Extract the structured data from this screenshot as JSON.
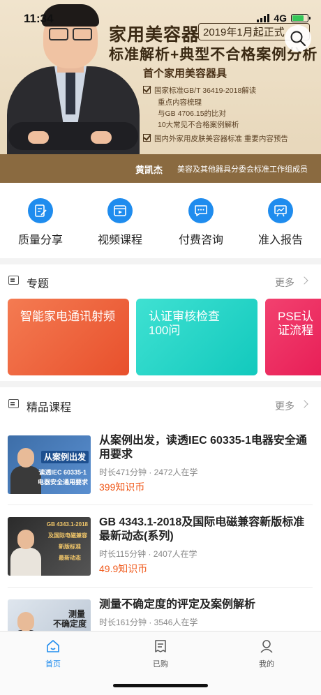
{
  "status_bar": {
    "time": "11:34",
    "network": "4G"
  },
  "banner": {
    "title": "家用美容器",
    "date_badge": "2019年1月起正式",
    "subtitle": "标准解析+典型不合格案例分析",
    "section": "首个家用美容器具",
    "check1": "国家标准GB/T 36419-2018解读",
    "line1": "重点内容梳理",
    "line2": "与GB 4706.15的比对",
    "line3": "10大常见不合格案例解析",
    "check2": "国内外家用皮肤美容器标准 重要内容预告",
    "speaker": "黄凯杰",
    "speaker_org": "美容及其他器具分委会标准工作组成员"
  },
  "quick_entries": [
    {
      "label": "质量分享",
      "icon": "edit-doc-icon"
    },
    {
      "label": "视频课程",
      "icon": "video-icon"
    },
    {
      "label": "付费咨询",
      "icon": "chat-icon"
    },
    {
      "label": "准入报告",
      "icon": "report-icon"
    }
  ],
  "topics_section": {
    "title": "专题",
    "more": "更多"
  },
  "topics": [
    {
      "title": "智能家电通讯射频",
      "color_from": "#f47b52",
      "color_to": "#e8502c"
    },
    {
      "title": "认证审核检查100问",
      "color_from": "#3fe1d2",
      "color_to": "#12c9bd"
    },
    {
      "title": "PSE认证流程",
      "color_from": "#f2416f",
      "color_to": "#e81f57"
    }
  ],
  "courses_section": {
    "title": "精品课程",
    "more": "更多"
  },
  "courses": [
    {
      "title": "从案例出发，读透IEC 60335-1电器安全通用要求",
      "meta": "时长471分钟 · 2472人在学",
      "price": "399知识币",
      "thumb_line1": "从案例出发",
      "thumb_line2": "读透IEC 60335-1",
      "thumb_line3": "电器安全通用要求"
    },
    {
      "title": "GB 4343.1-2018及国际电磁兼容新版标准最新动态(系列)",
      "meta": "时长115分钟 · 2407人在学",
      "price": "49.9知识币",
      "thumb_line1": "GB 4343.1-2018",
      "thumb_line2": "及国际电磁兼容",
      "thumb_line3": "新版标准",
      "thumb_line4": "最新动态"
    },
    {
      "title": "测量不确定度的评定及案例解析",
      "meta": "时长161分钟 · 3546人在学",
      "price": "",
      "thumb_line1": "测量",
      "thumb_line2": "不确定度"
    }
  ],
  "tabbar": [
    {
      "label": "首页",
      "icon": "home-icon",
      "active": true
    },
    {
      "label": "已购",
      "icon": "purchased-icon",
      "active": false
    },
    {
      "label": "我的",
      "icon": "profile-icon",
      "active": false
    }
  ],
  "colors": {
    "accent": "#1f8cee",
    "price": "#f05a1c"
  }
}
